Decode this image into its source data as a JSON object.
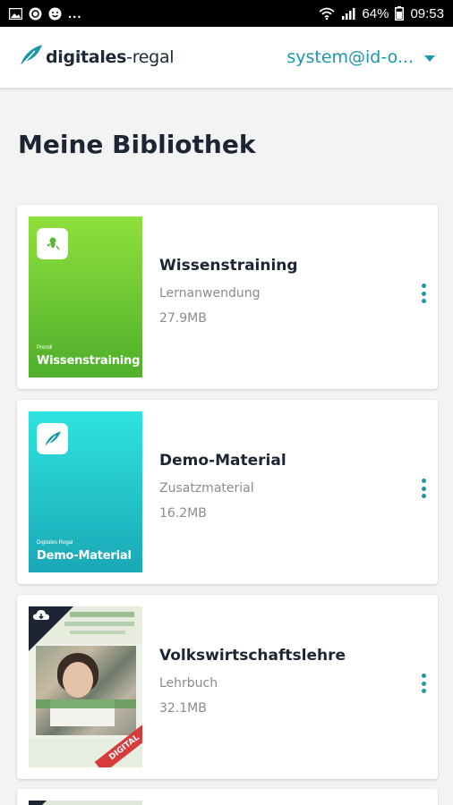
{
  "status_bar": {
    "left_ellipsis": "...",
    "battery": "64%",
    "time": "09:53"
  },
  "header": {
    "logo_bold": "digitales",
    "logo_regular": "-regal",
    "account": "system@id-o..."
  },
  "page_title": "Meine Bibliothek",
  "books": [
    {
      "title": "Wissenstraining",
      "type": "Lernanwendung",
      "size": "27.9MB",
      "cover_series": "Prendi",
      "cover_name": "Wissenstraining",
      "cover_color_top": "#8ee03c",
      "cover_color_bottom": "#4faf2c"
    },
    {
      "title": "Demo-Material",
      "type": "Zusatzmaterial",
      "size": "16.2MB",
      "cover_series": "Digitales Regal",
      "cover_name": "Demo-Material",
      "cover_color_top": "#2fe3e0",
      "cover_color_bottom": "#1aa8b6"
    },
    {
      "title": "Volkswirtschaftslehre",
      "type": "Lehrbuch",
      "size": "32.1MB",
      "cover_badge": "DIGITAL"
    }
  ],
  "colors": {
    "accent": "#1a98a8",
    "title": "#1d2535",
    "background": "#f3f3f3"
  }
}
